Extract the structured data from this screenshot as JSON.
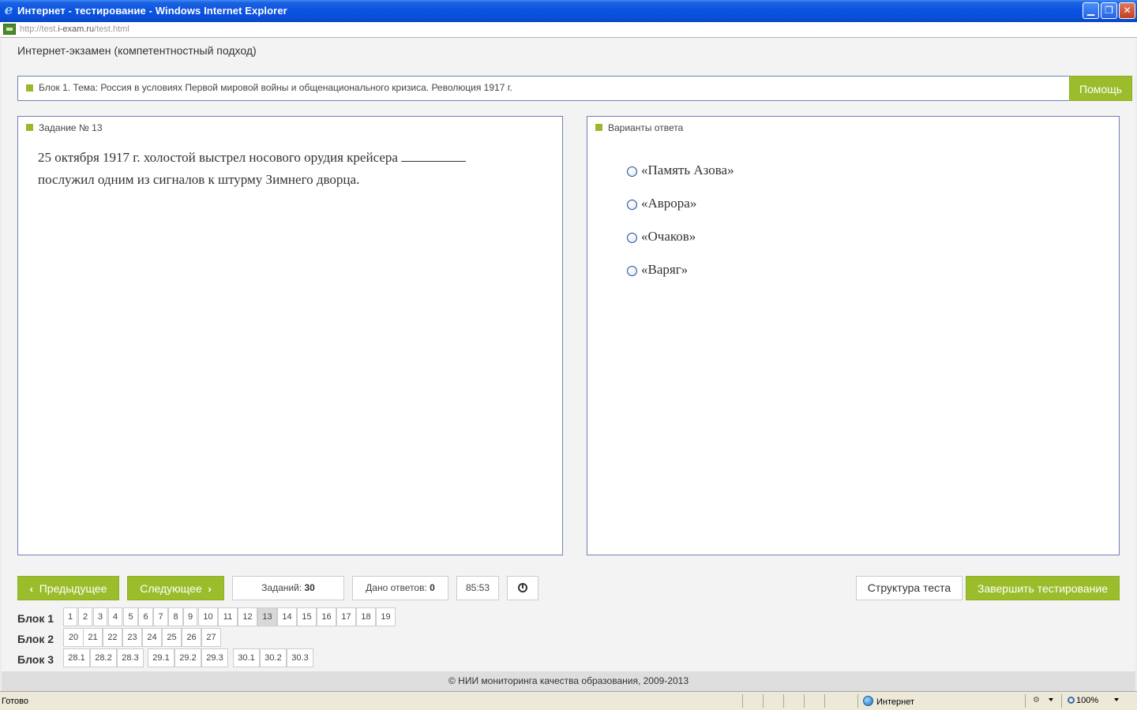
{
  "window": {
    "title": "Интернет - тестирование - Windows Internet Explorer",
    "url_prefix": "http://test.",
    "url_domain": "i-exam.ru",
    "url_suffix": "/test.html",
    "minimize": "▁",
    "maximize": "❐",
    "close": "✕"
  },
  "page": {
    "title": "Интернет-экзамен (компетентностный подход)",
    "block_topic": "Блок 1. Тема: Россия в условиях Первой мировой войны и общенационального кризиса. Революция 1917 г.",
    "help_label": "Помощь"
  },
  "task": {
    "header": "Задание № 13",
    "text_part1": "25 октября 1917 г. холостой выстрел носового орудия крейсера",
    "text_part2": "послужил одним из сигналов к штурму Зимнего дворца."
  },
  "answers": {
    "header": "Варианты ответа",
    "options": [
      "«Память Азова»",
      "«Аврора»",
      "«Очаков»",
      "«Варяг»"
    ]
  },
  "controls": {
    "prev_label": "Предыдущее",
    "next_label": "Следующее",
    "tasks_label": "Заданий:",
    "tasks_count": "30",
    "answers_label": "Дано ответов:",
    "answers_count": "0",
    "timer": "85:53",
    "structure_label": "Структура теста",
    "finish_label": "Завершить тестирование"
  },
  "blocks": [
    {
      "label": "Блок 1",
      "items": [
        "1",
        "2",
        "3",
        "4",
        "5",
        "6",
        "7",
        "8",
        "9",
        "10",
        "11",
        "12",
        "13",
        "14",
        "15",
        "16",
        "17",
        "18",
        "19"
      ],
      "active": "13"
    },
    {
      "label": "Блок 2",
      "items": [
        "20",
        "21",
        "22",
        "23",
        "24",
        "25",
        "26",
        "27"
      ]
    },
    {
      "label": "Блок 3",
      "items": [
        "28.1",
        "28.2",
        "28.3",
        "29.1",
        "29.2",
        "29.3",
        "30.1",
        "30.2",
        "30.3"
      ]
    }
  ],
  "footer": "© НИИ мониторинга качества образования, 2009-2013",
  "statusbar": {
    "status": "Готово",
    "zone": "Интернет",
    "zoom": "100%"
  },
  "colors": {
    "accent_green": "#9bbd2c",
    "titlebar_blue": "#0a54e3",
    "panel_border": "#6f7fb5"
  }
}
